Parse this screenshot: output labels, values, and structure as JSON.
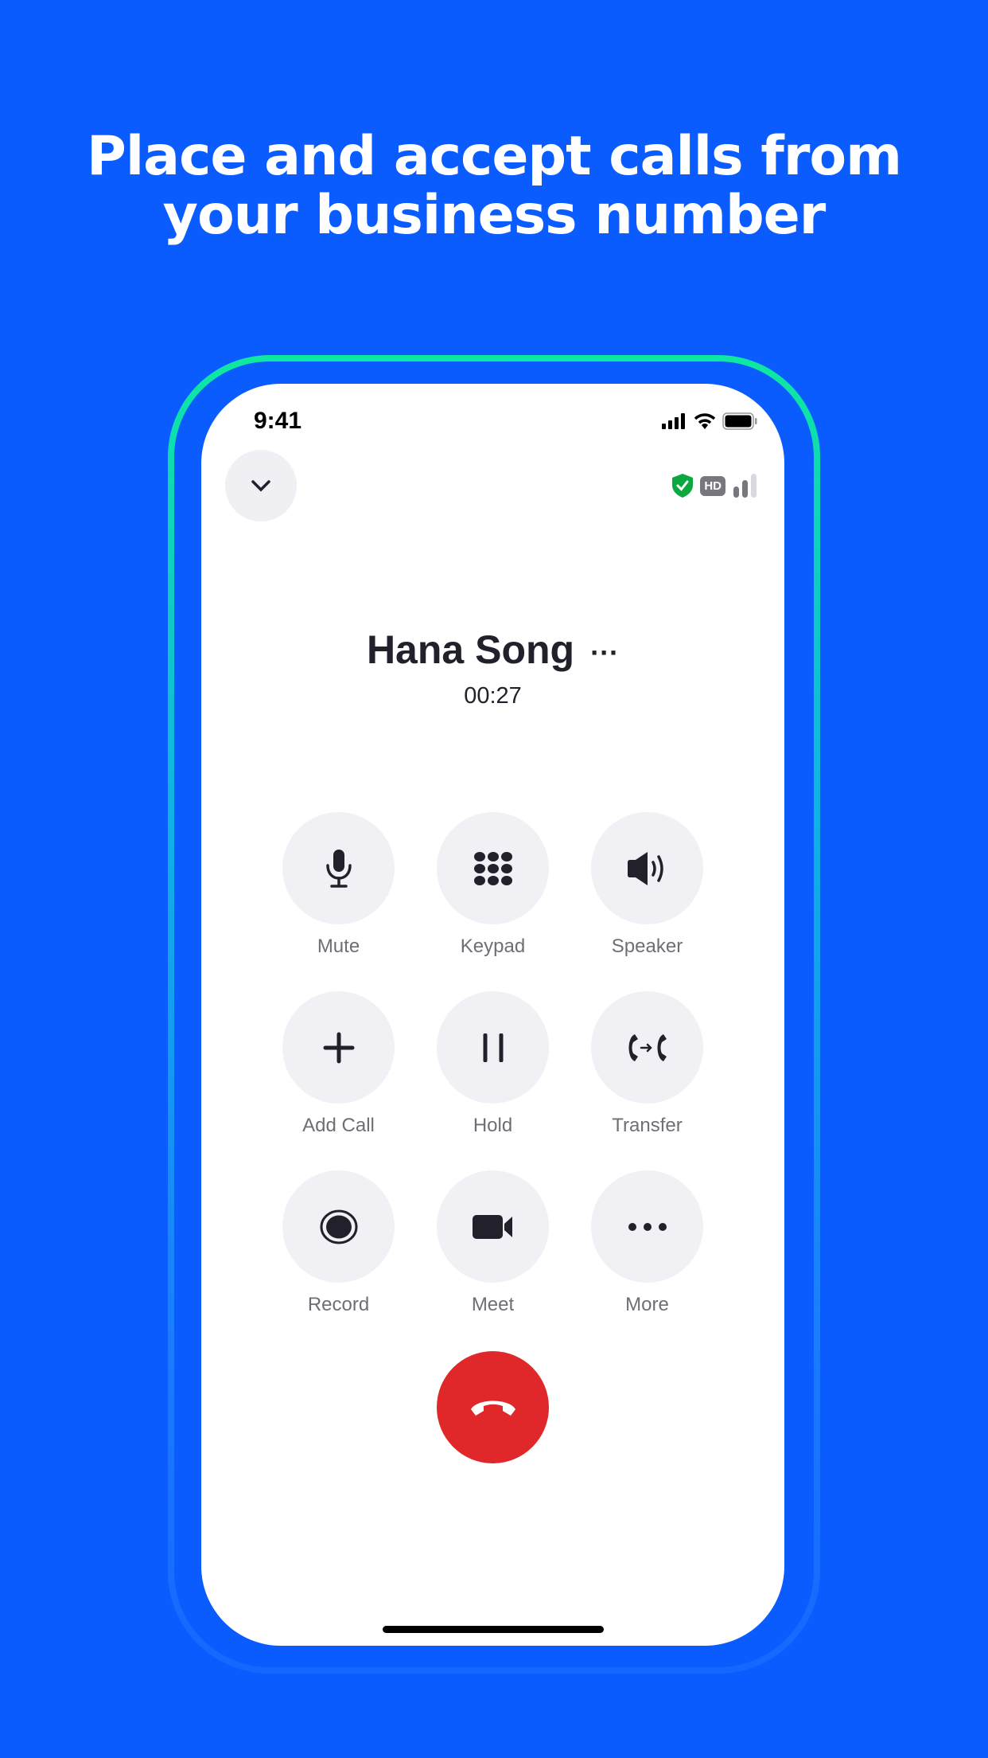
{
  "headline": {
    "line1": "Place and accept calls from",
    "line2": "your business number"
  },
  "status_bar": {
    "time": "9:41"
  },
  "call": {
    "hd_badge": "HD",
    "contact_name": "Hana Song",
    "more_dots": "···",
    "duration": "00:27"
  },
  "controls": [
    {
      "label": "Mute",
      "icon": "microphone-icon"
    },
    {
      "label": "Keypad",
      "icon": "keypad-icon"
    },
    {
      "label": "Speaker",
      "icon": "speaker-icon"
    },
    {
      "label": "Add Call",
      "icon": "plus-icon"
    },
    {
      "label": "Hold",
      "icon": "pause-icon"
    },
    {
      "label": "Transfer",
      "icon": "transfer-icon"
    },
    {
      "label": "Record",
      "icon": "record-icon"
    },
    {
      "label": "Meet",
      "icon": "video-camera-icon"
    },
    {
      "label": "More",
      "icon": "more-icon"
    }
  ],
  "colors": {
    "background": "#0b5cff",
    "end_call": "#e0282b",
    "secure": "#0aa83f"
  }
}
